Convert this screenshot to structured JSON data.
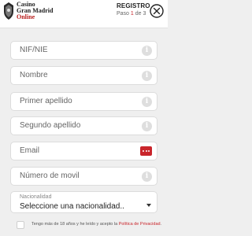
{
  "header": {
    "brand_line1": "Casino",
    "brand_line2": "Gran Madrid",
    "brand_line3": "Online",
    "title": "REGISTRO",
    "step_prefix": "Paso ",
    "step_current": "1",
    "step_suffix": " de 3",
    "close_icon": "close-circle-icon",
    "accent_color": "#c9252b"
  },
  "form": {
    "fields": [
      {
        "placeholder": "NIF/NIE",
        "icon": "info-icon"
      },
      {
        "placeholder": "Nombre",
        "icon": "info-icon"
      },
      {
        "placeholder": "Primer apellido",
        "icon": "info-icon"
      },
      {
        "placeholder": "Segundo apellido",
        "icon": "info-icon"
      },
      {
        "placeholder": "Email",
        "icon": "email-options-icon"
      },
      {
        "placeholder": "Número de movil",
        "icon": "info-icon"
      }
    ],
    "nationality": {
      "label": "Nacionalidad",
      "value": "Seleccione una nacionalidad.."
    }
  },
  "terms": {
    "text": "Tengo más de 18 años y he leído y acepto la ",
    "link_text": "Política de Privacidad",
    "end": "."
  }
}
